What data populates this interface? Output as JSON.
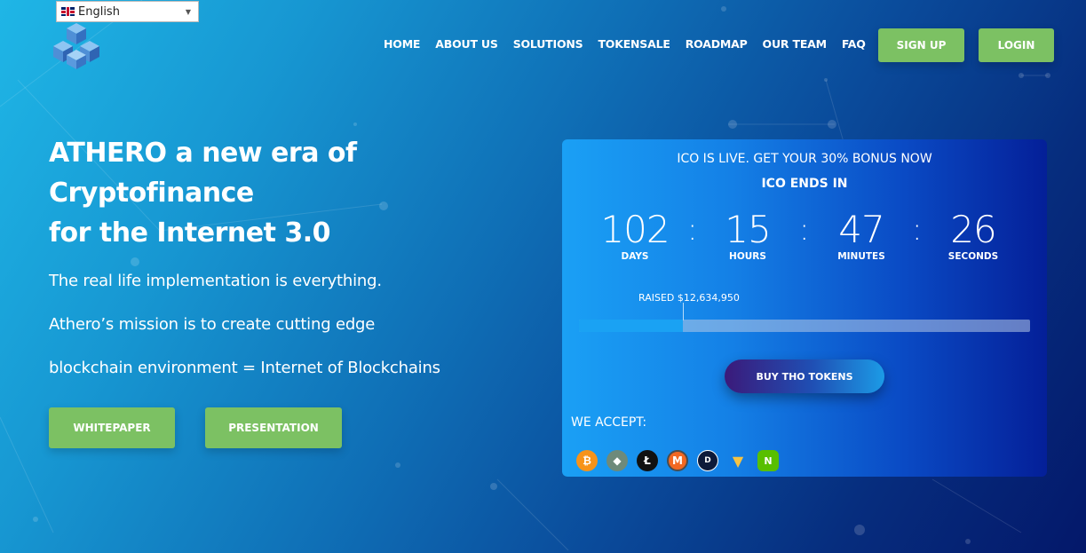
{
  "language": {
    "selected": "English"
  },
  "nav": {
    "items": [
      "HOME",
      "ABOUT US",
      "SOLUTIONS",
      "TOKENSALE",
      "ROADMAP",
      "OUR TEAM",
      "FAQ"
    ],
    "signup": "SIGN UP",
    "login": "LOGIN"
  },
  "hero": {
    "title_lines": [
      "ATHERO a new era of",
      "Cryptofinance",
      "for the Internet 3.0"
    ],
    "p1": "The real life implementation is everything.",
    "p2": "Athero’s mission is to create cutting edge",
    "p3": "blockchain environment = Internet of  Blockchains",
    "whitepaper": "WHITEPAPER",
    "presentation": "PRESENTATION"
  },
  "ico": {
    "live_text": "ICO IS LIVE. GET YOUR 30% BONUS NOW",
    "ends_text": "ICO ENDS IN",
    "days": "102",
    "days_label": "DAYS",
    "hours": "15",
    "hours_label": "HOURS",
    "minutes": "47",
    "minutes_label": "MINUTES",
    "seconds": "26",
    "seconds_label": "SECONDS",
    "raised": "RAISED $12,634,950",
    "progress_fraction": 0.23,
    "buy_label": "BUY THO TOKENS",
    "accept_label": "WE ACCEPT:",
    "coins": [
      "bitcoin-icon",
      "ethereum-icon",
      "litecoin-icon",
      "monero-icon",
      "dash-icon",
      "nem-icon",
      "neo-icon"
    ]
  },
  "colors": {
    "accent_green": "#7cc163",
    "progress_blue": "#1aa2f3"
  }
}
